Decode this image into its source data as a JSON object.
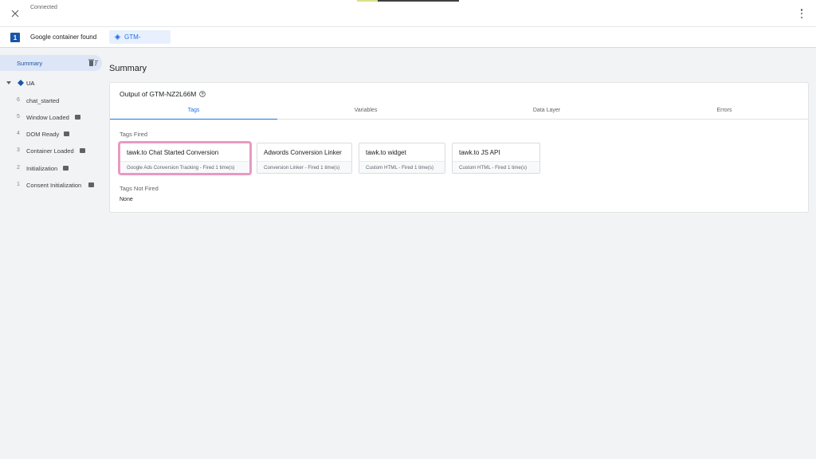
{
  "topbar": {
    "status": "Connected",
    "close_icon": "close-icon",
    "menu_icon": "more-vert-icon"
  },
  "container_bar": {
    "count": "1",
    "label": "Google container found",
    "chip_label": "GTM-"
  },
  "sidebar": {
    "summary_label": "Summary",
    "ua_label": "UA",
    "events": [
      {
        "num": "6",
        "name": "chat_started",
        "has_icon": false
      },
      {
        "num": "5",
        "name": "Window Loaded",
        "has_icon": true
      },
      {
        "num": "4",
        "name": "DOM Ready",
        "has_icon": true
      },
      {
        "num": "3",
        "name": "Container Loaded",
        "has_icon": true
      },
      {
        "num": "2",
        "name": "Initialization",
        "has_icon": true
      },
      {
        "num": "1",
        "name": "Consent Initialization",
        "has_icon": true
      }
    ]
  },
  "main": {
    "title": "Summary",
    "card": {
      "title": "Output of GTM-NZ2L66M",
      "tabs": [
        {
          "label": "Tags",
          "active": true
        },
        {
          "label": "Variables",
          "active": false
        },
        {
          "label": "Data Layer",
          "active": false
        },
        {
          "label": "Errors",
          "active": false
        }
      ],
      "tags_fired_label": "Tags Fired",
      "tags_fired": [
        {
          "name": "tawk.to Chat Started Conversion",
          "sub": "Google Ads Conversion Tracking - Fired 1 time(s)"
        },
        {
          "name": "Adwords Conversion Linker",
          "sub": "Conversion Linker - Fired 1 time(s)"
        },
        {
          "name": "tawk.to widget",
          "sub": "Custom HTML - Fired 1 time(s)"
        },
        {
          "name": "tawk.to JS API",
          "sub": "Custom HTML - Fired 1 time(s)"
        }
      ],
      "tags_not_fired_label": "Tags Not Fired",
      "tags_not_fired_value": "None"
    }
  },
  "colors": {
    "accent": "#1a73e8",
    "badge": "#1a56a8",
    "highlight": "#e89ac1"
  }
}
